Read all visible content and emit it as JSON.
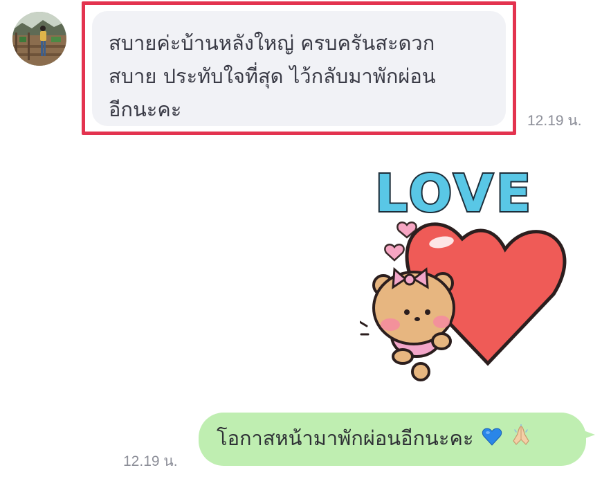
{
  "incoming": {
    "text_line1": "สบายค่ะบ้านหลังใหญ่ ครบครันสะดวก",
    "text_line2": "สบาย ประทับใจที่สุด ไว้กลับมาพักผ่อน",
    "text_line3": "อีกนะคะ",
    "time": "12.19 น."
  },
  "sticker": {
    "text": "LOVE"
  },
  "outgoing": {
    "text": "โอกาสหน้ามาพักผ่อนอีกนะคะ",
    "emojis": [
      "blue-heart-icon",
      "folded-hands-icon"
    ],
    "time": "12.19 น."
  },
  "colors": {
    "highlight_border": "#e3334f",
    "incoming_bubble": "#f1f2f6",
    "outgoing_bubble": "#bfeeb1",
    "timestamp": "#8d8f99"
  }
}
